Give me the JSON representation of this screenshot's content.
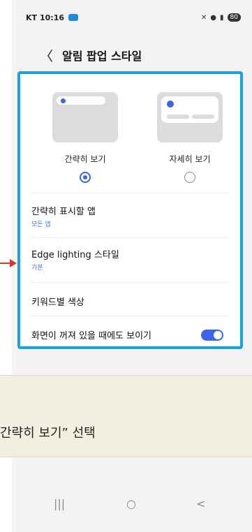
{
  "status_bar": {
    "carrier": "KT",
    "time": "10:16",
    "battery": "80"
  },
  "header": {
    "back_glyph": "〈",
    "title": "알림 팝업 스타일"
  },
  "options": [
    {
      "label": "간략히 보기",
      "selected": true
    },
    {
      "label": "자세히 보기",
      "selected": false
    }
  ],
  "settings": [
    {
      "title": "간략히 표시할 앱",
      "subtitle": "모든 앱"
    },
    {
      "title": "Edge lighting 스타일",
      "subtitle": "기본"
    },
    {
      "title": "키워드별 색상"
    },
    {
      "title": "화면이 꺼져 있을 때에도 보이기",
      "toggle_on": true
    }
  ],
  "caption": "간략히 보기” 선택",
  "nav": {
    "recents": "|||",
    "home": "○",
    "back": "<"
  },
  "colors": {
    "accent": "#3b63f0",
    "highlight_border": "#1aa3e0",
    "arrow": "#d9382b",
    "banner": "#f2eee0"
  }
}
